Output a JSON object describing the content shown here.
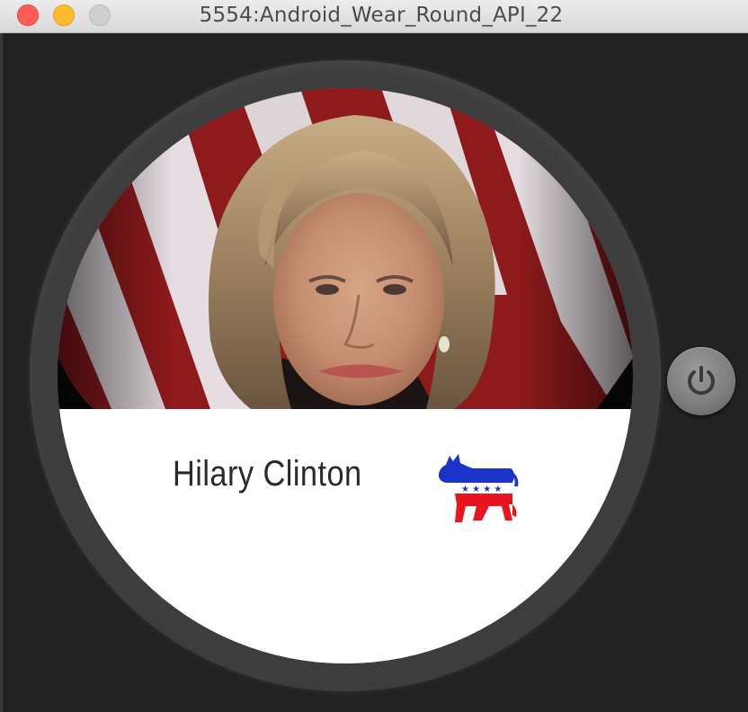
{
  "window": {
    "title": "5554:Android_Wear_Round_API_22"
  },
  "watch": {
    "candidate_photo": "candidate-photo",
    "candidate_name": "Hilary Clinton",
    "party_icon": "democratic-donkey-icon",
    "party_colors": {
      "blue": "#1a33c8",
      "red": "#e8141e"
    }
  },
  "controls": {
    "power_icon": "power-icon"
  },
  "colors": {
    "close": "#fd5f57",
    "minimize": "#febb2e",
    "zoom": "#cfcfcf",
    "bezel": "#3d3d3d",
    "background": "#222222"
  }
}
